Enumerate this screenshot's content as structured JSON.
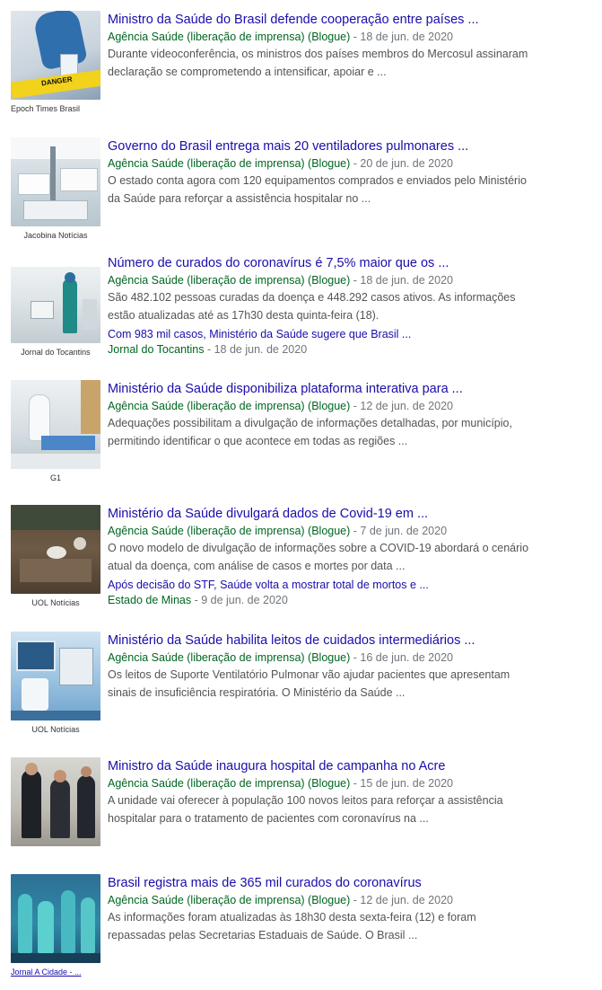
{
  "items": [
    {
      "thumb_source": "Epoch Times Brasil",
      "title": "Ministro da Saúde do Brasil defende cooperação entre países ...",
      "source": "Agência Saúde (liberação de imprensa) (Blogue)",
      "date": "18 de jun. de 2020",
      "desc_1": "Durante videoconferência, os ministros dos países membros do Mercosul assinaram",
      "desc_2": "declaração se comprometendo a intensificar, apoiar e ...",
      "thumb_text": "DANGER"
    },
    {
      "thumb_source": "Jacobina Notícias",
      "title": "Governo do Brasil entrega mais 20 ventiladores pulmonares ...",
      "source": "Agência Saúde (liberação de imprensa) (Blogue)",
      "date": "20 de jun. de 2020",
      "desc_1": "O estado conta agora com 120 equipamentos comprados e enviados pelo Ministério",
      "desc_2": "da Saúde para reforçar a assistência hospitalar no ..."
    },
    {
      "thumb_source": "Jornal do Tocantins",
      "title": "Número de curados do coronavírus é 7,5% maior que os ...",
      "source": "Agência Saúde (liberação de imprensa) (Blogue)",
      "date": "18 de jun. de 2020",
      "desc_1": "São 482.102 pessoas curadas da doença e 448.292 casos ativos. As informações",
      "desc_2": "estão atualizadas até as 17h30 desta quinta-feira (18).",
      "sub_title": "Com 983 mil casos, Ministério da Saúde sugere que Brasil ...",
      "sub_source": "Jornal do Tocantins",
      "sub_date": "18 de jun. de 2020"
    },
    {
      "thumb_source": "G1",
      "title": "Ministério da Saúde disponibiliza plataforma interativa para ...",
      "source": "Agência Saúde (liberação de imprensa) (Blogue)",
      "date": "12 de jun. de 2020",
      "desc_1": "Adequações possibilitam a divulgação de informações detalhadas, por município,",
      "desc_2": "permitindo identificar o que acontece em todas as regiões ..."
    },
    {
      "thumb_source": "UOL Notícias",
      "title": "Ministério da Saúde divulgará dados de Covid-19 em ...",
      "source": "Agência Saúde (liberação de imprensa) (Blogue)",
      "date": "7 de jun. de 2020",
      "desc_1": "O novo modelo de divulgação de informações sobre a COVID-19 abordará o cenário",
      "desc_2": "atual da doença, com análise de casos e mortes por data ...",
      "sub_title": "Após decisão do STF, Saúde volta a mostrar total de mortos e ...",
      "sub_source": "Estado de Minas",
      "sub_date": "9 de jun. de 2020"
    },
    {
      "thumb_source": "UOL Notícias",
      "title": "Ministério da Saúde habilita leitos de cuidados intermediários ...",
      "source": "Agência Saúde (liberação de imprensa) (Blogue)",
      "date": "16 de jun. de 2020",
      "desc_1": "Os leitos de Suporte Ventilatório Pulmonar vão ajudar pacientes que apresentam",
      "desc_2": "sinais de insuficiência respiratória. O Ministério da Saúde ..."
    },
    {
      "thumb_source": "",
      "title": "Ministro da Saúde inaugura hospital de campanha no Acre",
      "source": "Agência Saúde (liberação de imprensa) (Blogue)",
      "date": "15 de jun. de 2020",
      "desc_1": "A unidade vai oferecer à população 100 novos leitos para reforçar a assistência",
      "desc_2": "hospitalar para o tratamento de pacientes com coronavírus na ..."
    },
    {
      "thumb_source": "Jornal A Cidade - ...",
      "title": "Brasil registra mais de 365 mil curados do coronavírus",
      "source": "Agência Saúde (liberação de imprensa) (Blogue)",
      "date": "12 de jun. de 2020",
      "desc_1": "As informações foram atualizadas às 18h30 desta sexta-feira (12) e foram",
      "desc_2": "repassadas pelas Secretarias Estaduais de Saúde. O Brasil ..."
    }
  ],
  "meta_separator": " - "
}
